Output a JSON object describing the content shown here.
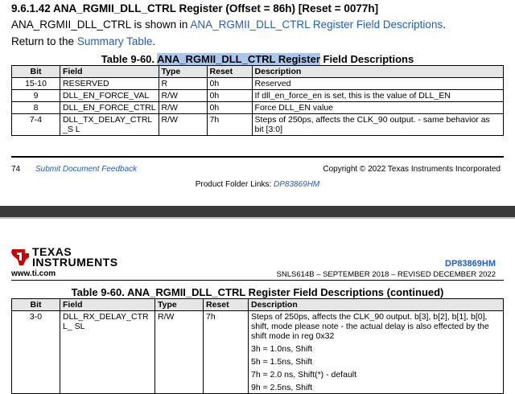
{
  "section_heading": "9.6.1.42 ANA_RGMII_DLL_CTRL Register (Offset = 86h) [Reset = 0077h]",
  "intro": {
    "prefix": "ANA_RGMII_DLL_CTRL is shown in ",
    "link": "ANA_RGMII_DLL_CTRL Register Field Descriptions",
    "suffix": "."
  },
  "return": {
    "prefix": "Return to the ",
    "link": "Summary Table",
    "suffix": "."
  },
  "table1": {
    "title_prefix": "Table 9-60. ",
    "title_highlight": "ANA_RGMII_DLL_CTRL Register",
    "title_suffix": " Field Descriptions",
    "headers": [
      "Bit",
      "Field",
      "Type",
      "Reset",
      "Description"
    ],
    "rows": [
      {
        "bit": "15-10",
        "field": "RESERVED",
        "type": "R",
        "reset": "0h",
        "desc": "Reserved"
      },
      {
        "bit": "9",
        "field": "DLL_EN_FORCE_VAL",
        "type": "R/W",
        "reset": "0h",
        "desc": "If dll_en_force_en is set, this is the value of DLL_EN"
      },
      {
        "bit": "8",
        "field": "DLL_EN_FORCE_CTRL",
        "type": "R/W",
        "reset": "0h",
        "desc": "Force DLL_EN value"
      },
      {
        "bit": "7-4",
        "field": "DLL_TX_DELAY_CTRL_S L",
        "type": "R/W",
        "reset": "7h",
        "desc": "Steps of 250ps, affects the CLK_90 output. - same behavior as bit [3:0]"
      }
    ]
  },
  "footer": {
    "page_number": "74",
    "feedback_link": "Submit Document Feedback",
    "copyright": "Copyright © 2022 Texas Instruments Incorporated",
    "product_folder_prefix": "Product Folder Links: ",
    "product_folder_link": "DP83869HM"
  },
  "header2": {
    "brand_line1": "TEXAS",
    "brand_line2": "INSTRUMENTS",
    "website": "www.ti.com",
    "part_number": "DP83869HM",
    "revision": "SNLS614B – SEPTEMBER 2018 – REVISED DECEMBER 2022"
  },
  "table2": {
    "title": "Table 9-60. ANA_RGMII_DLL_CTRL Register Field Descriptions (continued)",
    "headers": [
      "Bit",
      "Field",
      "Type",
      "Reset",
      "Description"
    ],
    "row": {
      "bit": "3-0",
      "field": "DLL_RX_DELAY_CTRL_ SL",
      "type": "R/W",
      "reset": "7h",
      "desc_lines": [
        "Steps of 250ps, affects the CLK_90 output. b[3], b[2], b[1], b[0], shift, mode please note - the actual delay is also effected by the shift mode in reg 0x32",
        "3h = 1.0ns, Shift",
        "5h = 1.5ns, Shift",
        "7h = 2.0 ns, Shift(*) - default",
        "9h = 2.5ns, Shift"
      ]
    }
  },
  "colors": {
    "link": "#1f5fbf",
    "highlight": "#a9c7ea",
    "ti_red": "#cc0000"
  }
}
